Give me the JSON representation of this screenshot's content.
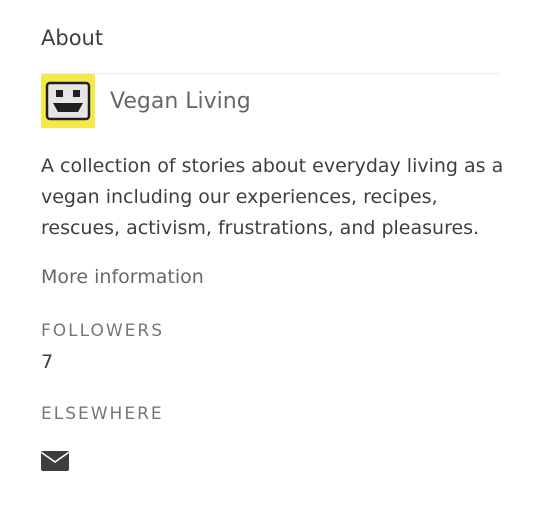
{
  "about": {
    "heading": "About",
    "publication": {
      "name": "Vegan Living",
      "avatar_icon": "robot-face-icon",
      "avatar_bg": "#f5e94a"
    },
    "description": "A collection of stories about everyday living as a vegan including our experiences, recipes, rescues, activism, frustrations, and pleasures.",
    "more_info_label": "More information",
    "followers": {
      "label": "FOLLOWERS",
      "count": "7"
    },
    "elsewhere": {
      "label": "ELSEWHERE",
      "icons": [
        "mail-icon"
      ]
    }
  }
}
